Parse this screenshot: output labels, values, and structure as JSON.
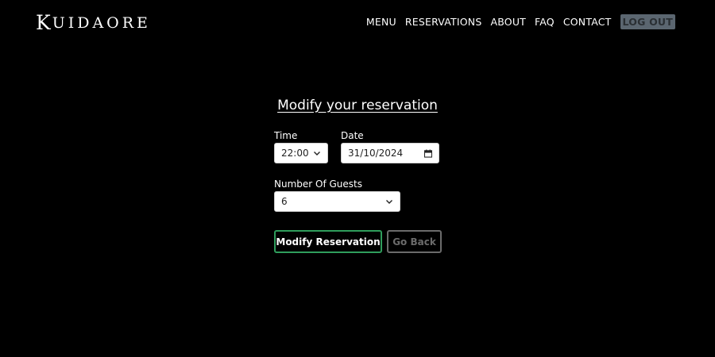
{
  "header": {
    "logo_first": "K",
    "logo_rest": "UIDAORE",
    "nav": [
      {
        "label": "MENU"
      },
      {
        "label": "RESERVATIONS"
      },
      {
        "label": "ABOUT"
      },
      {
        "label": "FAQ"
      },
      {
        "label": "CONTACT"
      }
    ],
    "logout_label": "LOG OUT"
  },
  "form": {
    "title": "Modify your reservation",
    "time": {
      "label": "Time",
      "value": "22:00"
    },
    "date": {
      "label": "Date",
      "value": "31/10/2024"
    },
    "guests": {
      "label": "Number Of Guests",
      "value": "6"
    },
    "submit_label": "Modify Reservation",
    "back_label": "Go Back"
  },
  "colors": {
    "background": "#000000",
    "primary_border": "#2f9d5c",
    "logout_bg": "#5b6670"
  }
}
